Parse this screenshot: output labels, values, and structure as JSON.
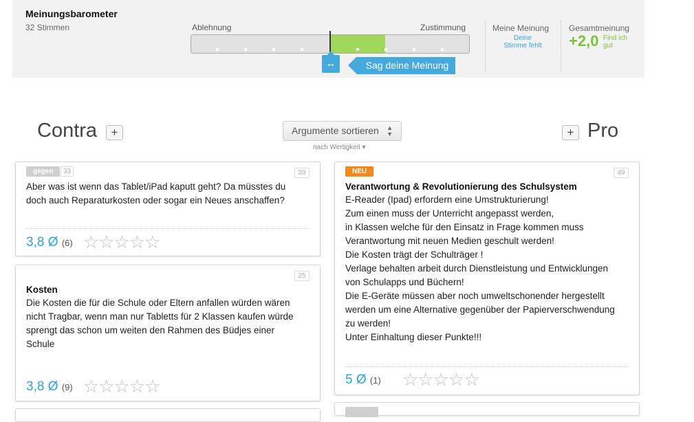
{
  "barometer": {
    "title": "Meinungsbarometer",
    "votes": "32 Stimmen",
    "left_label": "Ablehnung",
    "right_label": "Zustimmung",
    "handle_icon": "↔",
    "say_button": "Sag deine Meinung",
    "my_label": "Meine Meinung",
    "my_value": "Deine Stimme fehlt",
    "total_label": "Gesamtmeinung",
    "total_value": "+2,0",
    "total_text": "Find ich gut",
    "colors": {
      "accent": "#45a9dc",
      "positive": "#7cc13a",
      "fill": "#9fd85a"
    }
  },
  "columns": {
    "contra_title": "Contra",
    "pro_title": "Pro",
    "add_label": "+",
    "sort_label": "Argumente sortieren",
    "sort_arrows": "▲▼",
    "sort_sub": "nach Wertigkeit ▾"
  },
  "contra_cards": [
    {
      "tag": "gegen",
      "tag_count": "33",
      "number": "39",
      "title": "",
      "body": "Aber was ist wenn das Tablet/iPad kaputt geht? Da müsstes du\ndoch auch Reparaturkosten oder sogar ein Neues anschaffen?",
      "rating": "3,8",
      "rating_symbol": "Ø",
      "rating_count": "(6)",
      "stars": "☆☆☆☆☆"
    },
    {
      "number": "25",
      "title": "Kosten",
      "body": "Die Kosten die für die Schule oder Eltern anfallen würden wären\nnicht Tragbar, wenn man nur Tabletts für 2 Klassen kaufen würde\nsprengt das schon um weiten den Rahmen des Büdjes einer\nSchule",
      "rating": "3,8",
      "rating_symbol": "Ø",
      "rating_count": "(9)",
      "stars": "☆☆☆☆☆"
    }
  ],
  "pro_cards": [
    {
      "tag": "NEU",
      "number": "49",
      "title": "Verantwortung & Revolutionierung des Schulsystem",
      "body": "E-Reader (Ipad) erfordern eine Umstrukturierung!\nZum einen muss der Unterricht angepasst werden,\nin Klassen welche für den Einsatz in Frage kommen muss\nVerantwortung mit neuen Medien geschult werden!\nDie Kosten trägt der Schulträger !\nVerlage behalten arbeit durch Dienstleistung und Entwicklungen\nvon Schulapps und Büchern!\nDie E-Geräte müssen aber noch umweltschonender hergestellt\nwerden um eine Alternative gegenüber der Papierverschwendung\nzu werden!\nUnter Einhaltung dieser Punkte!!!",
      "rating": "5",
      "rating_symbol": "Ø",
      "rating_count": "(1)",
      "stars": "☆☆☆☆☆"
    }
  ]
}
